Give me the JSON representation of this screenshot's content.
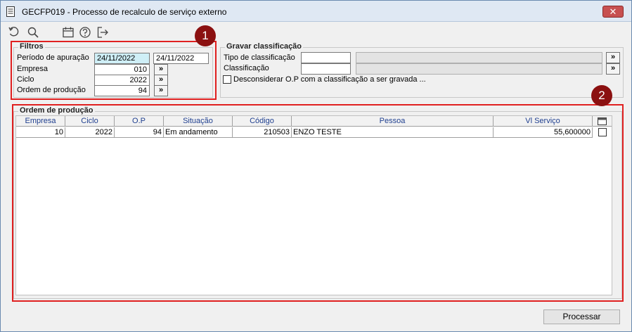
{
  "window": {
    "title": "GECFP019 - Processo de recalculo de serviço externo",
    "close_label": "✕"
  },
  "toolbar": {
    "icons": [
      "undo-icon",
      "search-icon",
      "calendar-icon",
      "help-icon",
      "exit-icon"
    ]
  },
  "filtros": {
    "legend": "Filtros",
    "periodo_label": "Período de apuração",
    "periodo_inicio": "24/11/2022",
    "periodo_fim": "24/11/2022",
    "empresa_label": "Empresa",
    "empresa_value": "010",
    "ciclo_label": "Ciclo",
    "ciclo_value": "2022",
    "ordem_label": "Ordem de produção",
    "ordem_value": "94",
    "lookup_label": "»"
  },
  "gravar": {
    "legend": "Gravar classificação",
    "tipo_label": "Tipo de classificação",
    "tipo_value": "",
    "tipo_desc": "",
    "classificacao_label": "Classificação",
    "classificacao_value": "",
    "classificacao_desc": "",
    "desconsiderar_label": "Desconsiderar O.P com a classificação a ser gravada ...",
    "lookup_label": "»"
  },
  "ordem": {
    "legend": "Ordem de produção",
    "columns": [
      "Empresa",
      "Ciclo",
      "O.P",
      "Situação",
      "Código",
      "Pessoa",
      "Vl Serviço"
    ],
    "rows": [
      {
        "empresa": "10",
        "ciclo": "2022",
        "op": "94",
        "situacao": "Em andamento",
        "codigo": "210503",
        "pessoa": "ENZO TESTE",
        "vl_servico": "55,600000"
      }
    ]
  },
  "annotations": {
    "badge1": "1",
    "badge2": "2"
  },
  "colors": {
    "annotation_red": "#e02020",
    "badge": "#8b1010",
    "header_text": "#1f3f8f",
    "highlight": "#cfeff7"
  },
  "footer": {
    "process_label": "Processar"
  }
}
